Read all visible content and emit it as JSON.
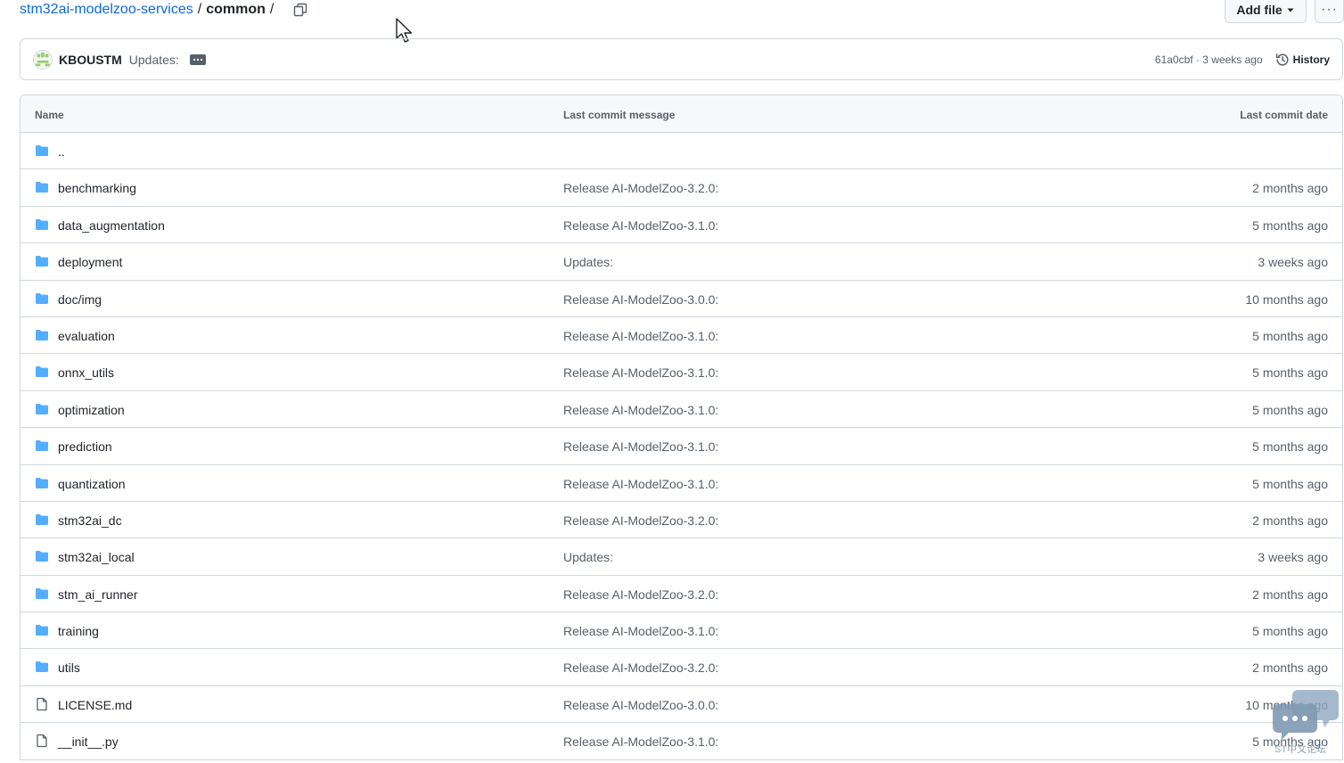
{
  "breadcrumb": {
    "repo": "stm32ai-modelzoo-services",
    "sep1": "/",
    "folder": "common",
    "sep2": "/"
  },
  "toolbar": {
    "add_file_label": "Add file",
    "more_label": "···"
  },
  "commit": {
    "author": "KBOUSTM",
    "message": "Updates:",
    "sha_time": "61a0cbf · 3 weeks ago",
    "history_label": "History"
  },
  "table": {
    "headers": {
      "name": "Name",
      "message": "Last commit message",
      "date": "Last commit date"
    },
    "rows": [
      {
        "type": "folder",
        "name": "..",
        "message": "",
        "date": ""
      },
      {
        "type": "folder",
        "name": "benchmarking",
        "message": "Release AI-ModelZoo-3.2.0:",
        "date": "2 months ago"
      },
      {
        "type": "folder",
        "name": "data_augmentation",
        "message": "Release AI-ModelZoo-3.1.0:",
        "date": "5 months ago"
      },
      {
        "type": "folder",
        "name": "deployment",
        "message": "Updates:",
        "date": "3 weeks ago"
      },
      {
        "type": "folder",
        "name": "doc/img",
        "message": "Release AI-ModelZoo-3.0.0:",
        "date": "10 months ago"
      },
      {
        "type": "folder",
        "name": "evaluation",
        "message": "Release AI-ModelZoo-3.1.0:",
        "date": "5 months ago"
      },
      {
        "type": "folder",
        "name": "onnx_utils",
        "message": "Release AI-ModelZoo-3.1.0:",
        "date": "5 months ago"
      },
      {
        "type": "folder",
        "name": "optimization",
        "message": "Release AI-ModelZoo-3.1.0:",
        "date": "5 months ago"
      },
      {
        "type": "folder",
        "name": "prediction",
        "message": "Release AI-ModelZoo-3.1.0:",
        "date": "5 months ago"
      },
      {
        "type": "folder",
        "name": "quantization",
        "message": "Release AI-ModelZoo-3.1.0:",
        "date": "5 months ago"
      },
      {
        "type": "folder",
        "name": "stm32ai_dc",
        "message": "Release AI-ModelZoo-3.2.0:",
        "date": "2 months ago"
      },
      {
        "type": "folder",
        "name": "stm32ai_local",
        "message": "Updates:",
        "date": "3 weeks ago"
      },
      {
        "type": "folder",
        "name": "stm_ai_runner",
        "message": "Release AI-ModelZoo-3.2.0:",
        "date": "2 months ago"
      },
      {
        "type": "folder",
        "name": "training",
        "message": "Release AI-ModelZoo-3.1.0:",
        "date": "5 months ago"
      },
      {
        "type": "folder",
        "name": "utils",
        "message": "Release AI-ModelZoo-3.2.0:",
        "date": "2 months ago"
      },
      {
        "type": "file",
        "name": "LICENSE.md",
        "message": "Release AI-ModelZoo-3.0.0:",
        "date": "10 months ago"
      },
      {
        "type": "file",
        "name": "__init__.py",
        "message": "Release AI-ModelZoo-3.1.0:",
        "date": "5 months ago"
      }
    ]
  },
  "watermark": {
    "text": "ST中文论坛"
  },
  "icons": {
    "folder": "folder-icon",
    "file": "file-icon",
    "copy": "copy-icon",
    "history": "history-icon",
    "caret": "caret-down-icon",
    "cursor": "mouse-cursor-icon"
  },
  "colors": {
    "link": "#0969da",
    "folder": "#54aeff",
    "border": "#d0d7de",
    "muted": "#57606a"
  }
}
